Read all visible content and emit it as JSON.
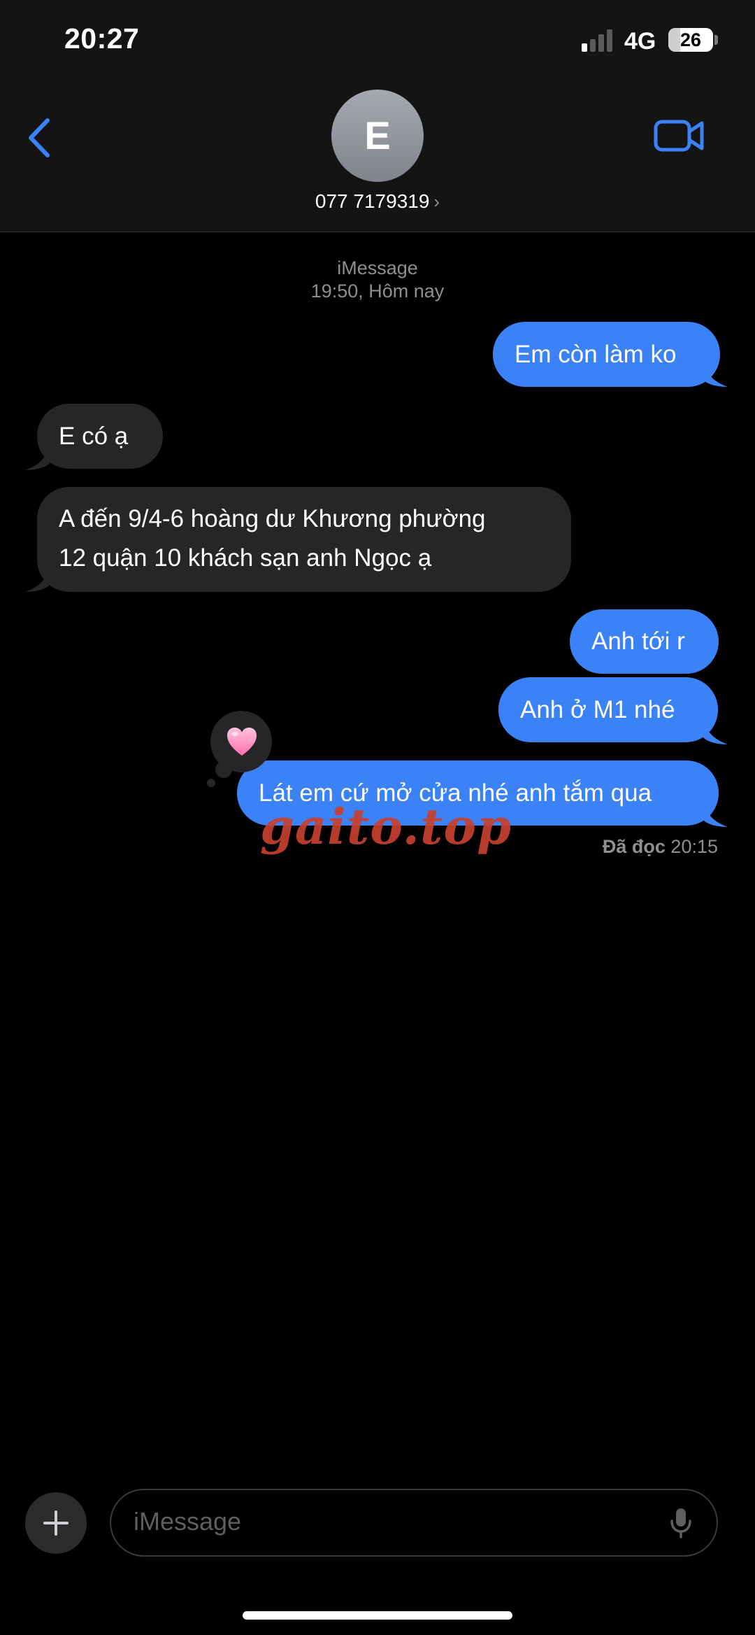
{
  "status_bar": {
    "time": "20:27",
    "network": "4G",
    "battery": "26",
    "battery_level": 0.26,
    "signal_bars": 1
  },
  "header": {
    "avatar_initial": "E",
    "contact": "077 7179319",
    "chevron": "›",
    "icons": {
      "back": "chevron-left-icon",
      "video": "video-camera-icon"
    },
    "accent_color": "#3b82f6"
  },
  "conversation": {
    "service": "iMessage",
    "timestamp": "19:50, Hôm nay",
    "messages": [
      {
        "direction": "outgoing",
        "text": "Em còn làm ko"
      },
      {
        "direction": "incoming",
        "text": "E có ạ"
      },
      {
        "direction": "incoming",
        "lines": [
          "A đến 9/4-6 hoàng dư Khương phường",
          "12 quận 10 khách sạn anh Ngọc ạ"
        ]
      },
      {
        "direction": "outgoing",
        "text": "Anh tới r"
      },
      {
        "direction": "outgoing",
        "text": "Anh ở M1 nhé"
      },
      {
        "direction": "outgoing",
        "text": "Lát em cứ mở cửa nhé anh tắm qua",
        "tapback": "pink-heart-icon"
      }
    ],
    "read_receipt": {
      "label": "Đã đọc",
      "time": "20:15"
    },
    "watermark": "gaito.top"
  },
  "composer": {
    "placeholder": "iMessage",
    "icons": {
      "add": "plus-icon",
      "mic": "microphone-icon"
    }
  }
}
